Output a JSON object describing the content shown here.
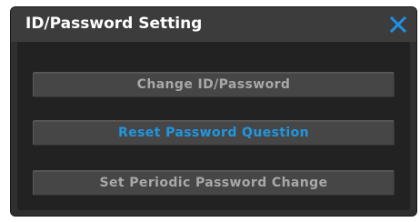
{
  "dialog": {
    "title": "ID/Password Setting",
    "close_icon": "close-icon",
    "accent_color": "#2196e0",
    "buttons": [
      {
        "label": "Change ID/Password",
        "active": false
      },
      {
        "label": "Reset Password Question",
        "active": true
      },
      {
        "label": "Set Periodic Password Change",
        "active": false
      }
    ]
  }
}
